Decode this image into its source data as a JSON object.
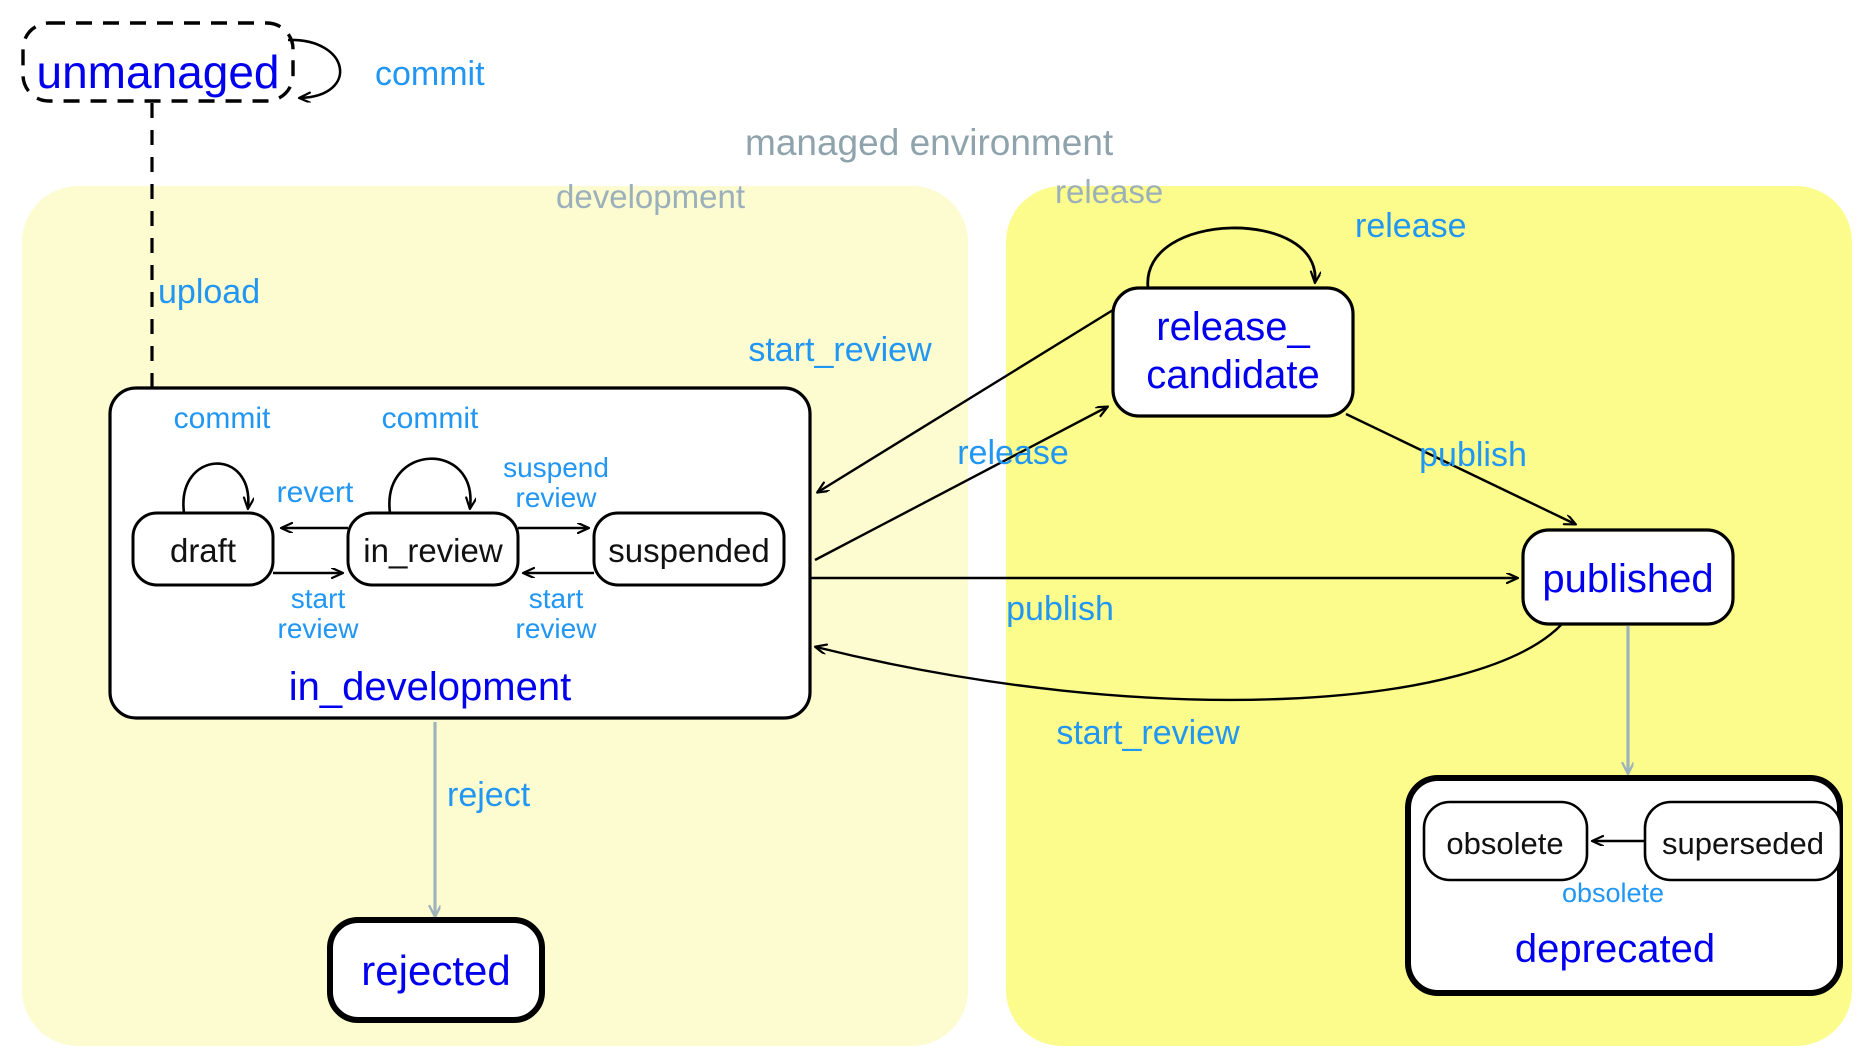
{
  "diagram": {
    "title": "managed environment",
    "regions": [
      {
        "id": "managed",
        "label": "managed environment",
        "label_color": "#8fa3ad"
      },
      {
        "id": "development",
        "label": "development",
        "fill": "#fdfbd0",
        "label_color": "#9bb0ba"
      },
      {
        "id": "release",
        "label": "release",
        "fill": "#fcfc8c",
        "label_color": "#9bb0ba"
      }
    ],
    "colors": {
      "state_text": "#0000ee",
      "inner_state_text": "#111111",
      "transition_label": "#2196f3",
      "gray_arrow": "#9fb3bb",
      "stroke": "#000000",
      "state_fill": "#ffffff",
      "development_fill": "#fdfbd0",
      "release_fill": "#fcfc8c"
    },
    "states": [
      {
        "id": "unmanaged",
        "label": "unmanaged",
        "style": "dashed",
        "text_color": "#0000ee"
      },
      {
        "id": "in_development",
        "label": "in_development",
        "style": "composite",
        "text_color": "#0000ee"
      },
      {
        "id": "draft",
        "label": "draft",
        "style": "simple",
        "text_color": "#111111"
      },
      {
        "id": "in_review",
        "label": "in_review",
        "style": "simple",
        "text_color": "#111111"
      },
      {
        "id": "suspended",
        "label": "suspended",
        "style": "simple",
        "text_color": "#111111"
      },
      {
        "id": "release_candidate",
        "label_line1": "release_",
        "label_line2": "candidate",
        "label": "release_candidate",
        "style": "simple",
        "text_color": "#0000ee"
      },
      {
        "id": "published",
        "label": "published",
        "style": "simple",
        "text_color": "#0000ee"
      },
      {
        "id": "deprecated",
        "label": "deprecated",
        "style": "composite-bold",
        "text_color": "#0000ee"
      },
      {
        "id": "obsolete",
        "label": "obsolete",
        "style": "simple",
        "text_color": "#111111"
      },
      {
        "id": "superseded",
        "label": "superseded",
        "style": "simple",
        "text_color": "#111111"
      },
      {
        "id": "rejected",
        "label": "rejected",
        "style": "final-bold",
        "text_color": "#0000ee"
      }
    ],
    "transitions": [
      {
        "id": "t1",
        "from": "unmanaged",
        "to": "unmanaged",
        "label": "commit"
      },
      {
        "id": "t2",
        "from": "unmanaged",
        "to": "draft",
        "label": "upload"
      },
      {
        "id": "t3",
        "from": "draft",
        "to": "draft",
        "label": "commit"
      },
      {
        "id": "t4",
        "from": "in_review",
        "to": "in_review",
        "label": "commit"
      },
      {
        "id": "t5",
        "from": "in_review",
        "to": "draft",
        "label": "revert"
      },
      {
        "id": "t6",
        "from": "draft",
        "to": "in_review",
        "label_line1": "start",
        "label_line2": "review",
        "label": "start review"
      },
      {
        "id": "t7",
        "from": "in_review",
        "to": "suspended",
        "label_line1": "suspend",
        "label_line2": "review",
        "label": "suspend review"
      },
      {
        "id": "t8",
        "from": "suspended",
        "to": "in_review",
        "label_line1": "start",
        "label_line2": "review",
        "label": "start review"
      },
      {
        "id": "t9",
        "from": "release_candidate",
        "to": "in_development",
        "label": "start_review"
      },
      {
        "id": "t10",
        "from": "in_development",
        "to": "release_candidate",
        "label": "release"
      },
      {
        "id": "t11",
        "from": "release_candidate",
        "to": "release_candidate",
        "label": "release"
      },
      {
        "id": "t12",
        "from": "release_candidate",
        "to": "published",
        "label": "publish"
      },
      {
        "id": "t13",
        "from": "in_development",
        "to": "published",
        "label": "publish"
      },
      {
        "id": "t14",
        "from": "published",
        "to": "in_development",
        "label": "start_review"
      },
      {
        "id": "t15",
        "from": "published",
        "to": "deprecated",
        "label": "",
        "style": "gray"
      },
      {
        "id": "t16",
        "from": "in_development",
        "to": "rejected",
        "label": "reject",
        "style": "gray"
      },
      {
        "id": "t17",
        "from": "superseded",
        "to": "obsolete",
        "label": "obsolete"
      }
    ]
  }
}
